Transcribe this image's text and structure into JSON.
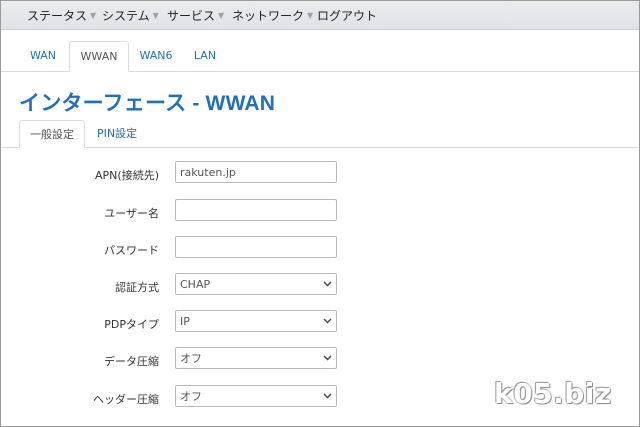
{
  "topmenu": [
    {
      "label": "ステータス"
    },
    {
      "label": "システム"
    },
    {
      "label": "サービス"
    },
    {
      "label": "ネットワーク"
    },
    {
      "label": "ログアウト"
    }
  ],
  "interface_tabs": [
    {
      "label": "WAN"
    },
    {
      "label": "WWAN"
    },
    {
      "label": "WAN6"
    },
    {
      "label": "LAN"
    }
  ],
  "page_title": "インターフェース - WWAN",
  "section_tabs": [
    {
      "label": "一般設定"
    },
    {
      "label": "PIN設定"
    }
  ],
  "form": {
    "apn": {
      "label": "APN(接続先)",
      "value": "rakuten.jp"
    },
    "username": {
      "label": "ユーザー名",
      "value": ""
    },
    "password": {
      "label": "パスワード",
      "value": ""
    },
    "auth": {
      "label": "認証方式",
      "value": "CHAP"
    },
    "pdp": {
      "label": "PDPタイプ",
      "value": "IP"
    },
    "data_compression": {
      "label": "データ圧縮",
      "value": "オフ"
    },
    "header_compression": {
      "label": "ヘッダー圧縮",
      "value": "オフ"
    }
  },
  "watermark": "k05.biz",
  "colors": {
    "link": "#1e6fb8",
    "title": "#1f6fc0",
    "menubar": "#e3e7eb"
  }
}
